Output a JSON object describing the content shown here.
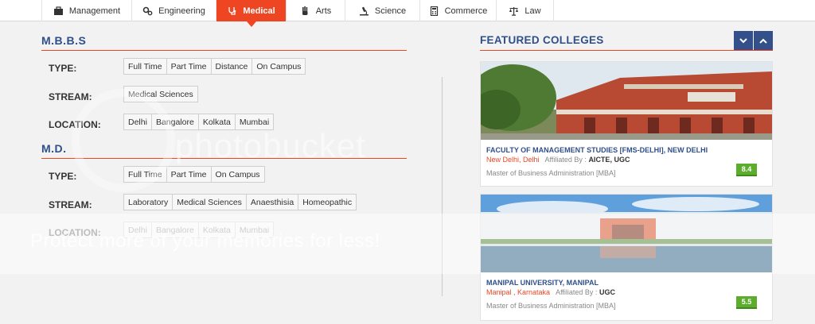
{
  "tabs": [
    {
      "label": "Management",
      "icon": "briefcase-icon",
      "active": false
    },
    {
      "label": "Engineering",
      "icon": "gears-icon",
      "active": false
    },
    {
      "label": "Medical",
      "icon": "stethoscope-icon",
      "active": true
    },
    {
      "label": "Arts",
      "icon": "hand-icon",
      "active": false
    },
    {
      "label": "Science",
      "icon": "microscope-icon",
      "active": false
    },
    {
      "label": "Commerce",
      "icon": "calculator-icon",
      "active": false
    },
    {
      "label": "Law",
      "icon": "scales-icon",
      "active": false
    }
  ],
  "mbbs": {
    "title": "M.B.B.S",
    "type_label": "TYPE:",
    "types": [
      "Full Time",
      "Part Time",
      "Distance",
      "On Campus"
    ],
    "stream_label": "STREAM:",
    "streams": [
      "Medical Sciences"
    ],
    "location_label": "LOCATION:",
    "locations": [
      "Delhi",
      "Bangalore",
      "Kolkata",
      "Mumbai"
    ]
  },
  "md": {
    "title": "M.D.",
    "type_label": "TYPE:",
    "types": [
      "Full Time",
      "Part Time",
      "On Campus"
    ],
    "stream_label": "STREAM:",
    "streams": [
      "Laboratory",
      "Medical Sciences",
      "Anaesthisia",
      "Homeopathic"
    ],
    "location_label": "LOCATION:",
    "locations": [
      "Delhi",
      "Bangalore",
      "Kolkata",
      "Mumbai"
    ]
  },
  "featured": {
    "title": "FEATURED COLLEGES",
    "colleges": [
      {
        "name": "FACULTY OF MANAGEMENT STUDIES [FMS-DELHI], NEW DELHI",
        "location": "New Delhi, Delhi",
        "affiliated_label": "Affiliated By :",
        "affiliation": "AICTE, UGC",
        "course": "Master of Business Administration [MBA]",
        "rating": "8.4"
      },
      {
        "name": "MANIPAL UNIVERSITY, MANIPAL",
        "location": "Manipal , Karnataka",
        "affiliated_label": "Affiliated By :",
        "affiliation": "UGC",
        "course": "Master of Business Administration [MBA]",
        "rating": "5.5"
      }
    ]
  },
  "watermark": {
    "logo": "photobucket",
    "text": "Protect more of your memories for less!"
  },
  "colors": {
    "accent": "#ee4523",
    "heading": "#2f4f8a",
    "rating": "#5cad2e"
  }
}
